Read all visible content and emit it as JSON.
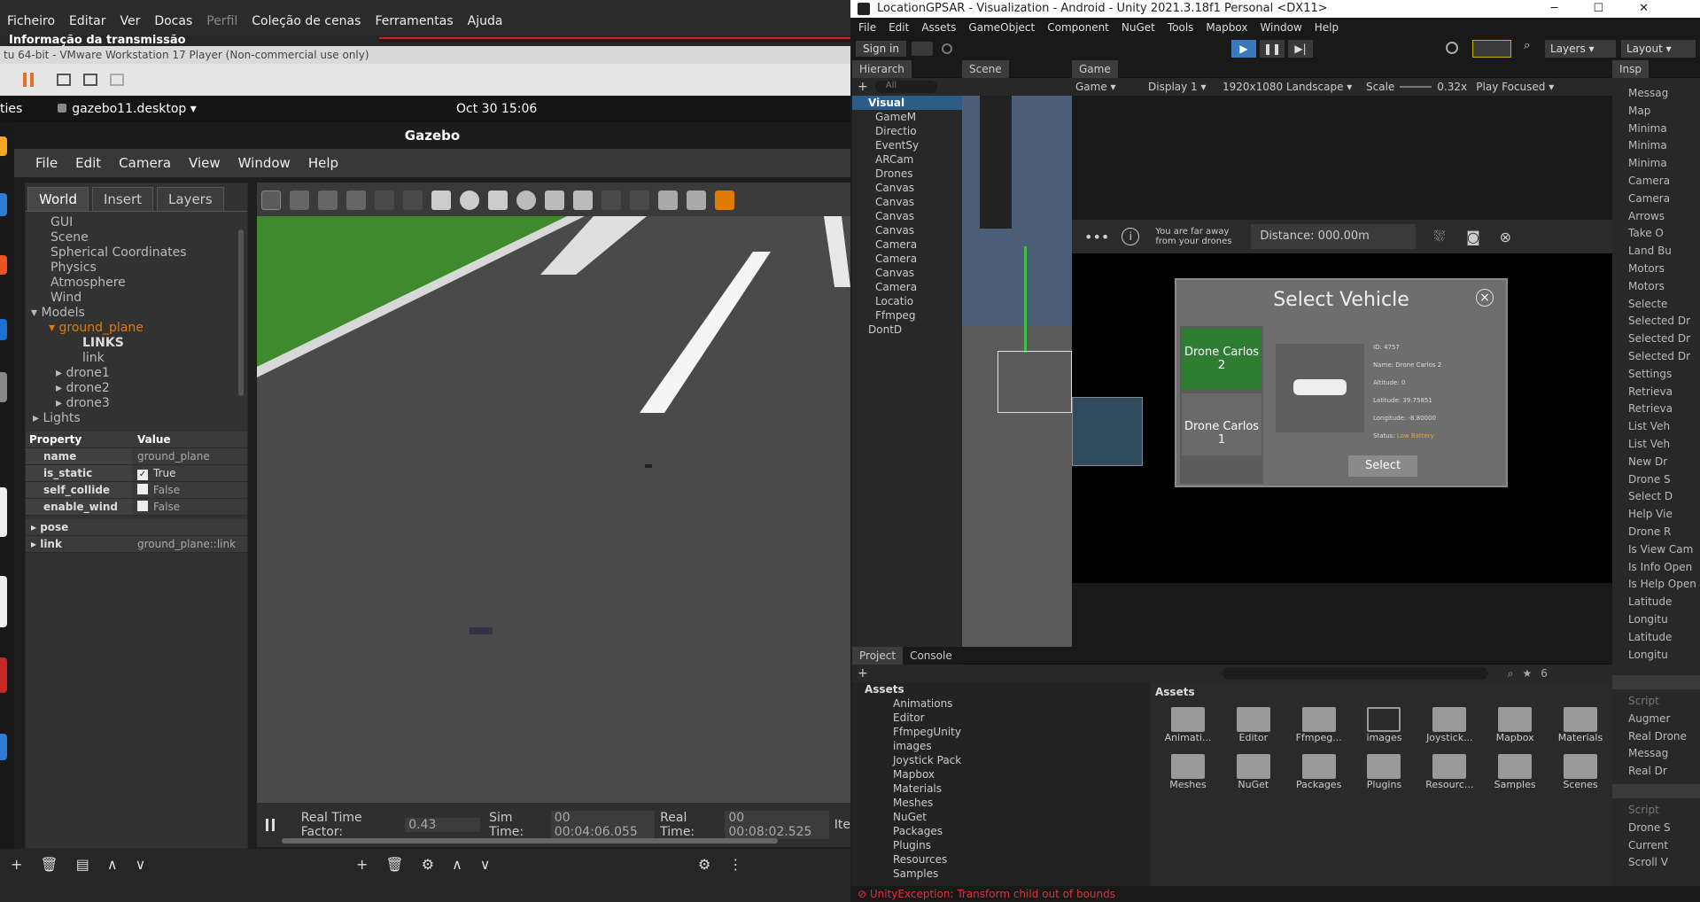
{
  "obs": {
    "menu": [
      "Ficheiro",
      "Editar",
      "Ver",
      "Docas",
      "Perfil",
      "Coleção de cenas",
      "Ferramentas",
      "Ajuda"
    ],
    "dock_title": "Informação da transmissão"
  },
  "vmware": {
    "title": "tu 64-bit - VMware Workstation 17 Player (Non-commercial use only)"
  },
  "ubuntu": {
    "activities": "ties",
    "app_name": "gazebo11.desktop",
    "clock": "Oct 30  15:06"
  },
  "gazebo": {
    "title": "Gazebo",
    "menu": [
      "File",
      "Edit",
      "Camera",
      "View",
      "Window",
      "Help"
    ],
    "tabs": [
      "World",
      "Insert",
      "Layers"
    ],
    "tree": [
      "GUI",
      "Scene",
      "Spherical Coordinates",
      "Physics",
      "Atmosphere",
      "Wind",
      "Models"
    ],
    "model_selected": "ground_plane",
    "links_label": "LINKS",
    "link_item": "link",
    "drones": [
      "drone1",
      "drone2",
      "drone3"
    ],
    "lights": "Lights",
    "prop_header": {
      "property": "Property",
      "value": "Value"
    },
    "props": [
      {
        "k": "name",
        "v": "ground_plane"
      },
      {
        "k": "is_static",
        "v": "True",
        "checked": true
      },
      {
        "k": "self_collide",
        "v": "False",
        "checked": false
      },
      {
        "k": "enable_wind",
        "v": "False",
        "checked": false
      }
    ],
    "pose_label": "pose",
    "link_label": "link",
    "link_value": "ground_plane::link",
    "status": {
      "rtf_label": "Real Time Factor:",
      "rtf_value": "0.43",
      "sim_label": "Sim Time:",
      "sim_value": "00 00:04:06.055",
      "real_label": "Real Time:",
      "real_value": "00 00:08:02.525",
      "iter": "Ite"
    }
  },
  "unity": {
    "title": "LocationGPSAR - Visualization - Android - Unity 2021.3.18f1 Personal <DX11>",
    "menu": [
      "File",
      "Edit",
      "Assets",
      "GameObject",
      "Component",
      "NuGet",
      "Tools",
      "Mapbox",
      "Window",
      "Help"
    ],
    "sign_in": "Sign in",
    "layers": "Layers",
    "layout": "Layout",
    "tabs": {
      "hierarchy": "Hierarch",
      "scene": "Scene",
      "game": "Game",
      "inspector": "Insp"
    },
    "search_placeholder": "All",
    "game_bar": {
      "mode": "Game",
      "display": "Display 1",
      "resolution": "1920x1080 Landscape",
      "scale_label": "Scale",
      "scale_value": "0.32x",
      "play": "Play Focused"
    },
    "hierarchy": [
      "Visual",
      "GameM",
      "Directio",
      "EventSy",
      "ARCam",
      "Drones",
      "Canvas",
      "Canvas",
      "Canvas",
      "Canvas",
      "Camera",
      "Camera",
      "Canvas",
      "Camera",
      "Locatio",
      "Ffmpeg",
      "DontD"
    ],
    "game_ui": {
      "far_msg": "You are far away from your drones",
      "distance": "Distance: 000.00m",
      "dialog_title": "Select Vehicle",
      "close": "×",
      "drone_a": "Drone Carlos 2",
      "drone_b": "Drone Carlos 1",
      "info_labels": [
        "ID:",
        "Name:",
        "Altitude:",
        "Latitude:",
        "Longitude:",
        "Status:"
      ],
      "info_values": [
        "4757",
        "Drone Carlos 2",
        "0",
        "39.75851",
        "-8.80000",
        "Low Battery"
      ],
      "select": "Select"
    },
    "project": {
      "tab_project": "Project",
      "tab_console": "Console",
      "tree": [
        "Assets",
        "Animations",
        "Editor",
        "FfmpegUnity",
        "images",
        "Joystick Pack",
        "Mapbox",
        "Materials",
        "Meshes",
        "NuGet",
        "Packages",
        "Plugins",
        "Resources",
        "Samples"
      ],
      "breadcrumb": "Assets",
      "assets": [
        "Animati...",
        "Editor",
        "Ffmpeg...",
        "images",
        "Joystick...",
        "Mapbox",
        "Materials",
        "Meshes",
        "NuGet",
        "Packages",
        "Plugins",
        "Resourc...",
        "Samples",
        "Scenes"
      ],
      "count": "6"
    },
    "inspector": [
      "Messag",
      "Map",
      "Minima",
      "Minima",
      "Minima",
      "Camera",
      "Camera",
      "Arrows",
      "Take O",
      "Land Bu",
      "Motors",
      "Motors",
      "Selecte",
      "Selected Dr",
      "Selected Dr",
      "Selected Dr",
      "Settings",
      "Retrieva",
      "Retrieva",
      "List Veh",
      "List Veh",
      "New Dr",
      "Drone S",
      "Select D",
      "Help Vie",
      "Drone R",
      "Is View Cam",
      "Is Info Open",
      "Is Help Open",
      "Latitude",
      "Longitu",
      "Latitude",
      "Longitu"
    ],
    "inspector2": [
      "Script",
      "Augmer",
      "Real Drone",
      "Messag",
      "Real Dr"
    ],
    "inspector3": [
      "Script",
      "Drone S",
      "Current",
      "Scroll V"
    ],
    "error": "UnityException: Transform child out of bounds"
  },
  "colors": {
    "unity_play": "#3a79bb",
    "gazebo_select": "#e07b00",
    "button_green": "#2e7d32"
  }
}
